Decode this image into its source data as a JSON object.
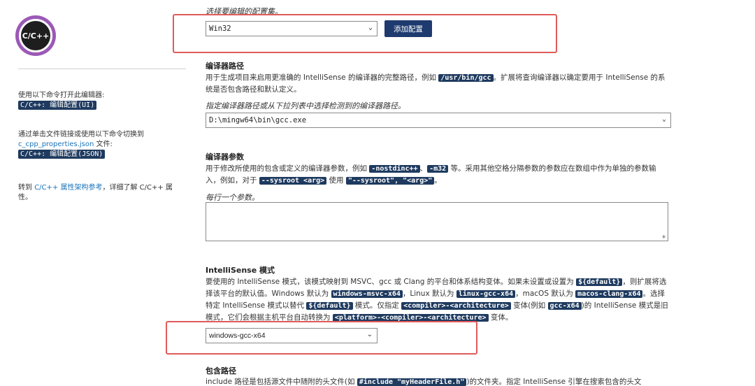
{
  "logo": {
    "text": "C/C++"
  },
  "sidebar": {
    "open_editor_text": "使用以下命令打开此编辑器:",
    "open_editor_cmd": "C/C++: 编辑配置(UI)",
    "switch_text_1": "通过单击文件链接或使用以下命令切换到",
    "switch_link": "c_cpp_properties.json",
    "switch_text_2": " 文件:",
    "switch_cmd": "C/C++: 编辑配置(JSON)",
    "ref_text_1": "转到 ",
    "ref_link": "C/C++ 属性架构参考",
    "ref_text_2": "，详细了解 C/C++ 属性。"
  },
  "config": {
    "hint": "选择要编辑的配置集。",
    "selected": "Win32",
    "add_button": "添加配置"
  },
  "compiler_path": {
    "title": "编译器路径",
    "desc_1": "用于生成项目来启用更准确的 IntelliSense 的编译器的完整路径，例如 ",
    "code_1": "/usr/bin/gcc",
    "desc_2": "。扩展将查询编译器以确定要用于 IntelliSense 的系统是否包含路径和默认定义。",
    "hint": "指定编译器路径或从下拉列表中选择检测到的编译器路径。",
    "value": "D:\\mingw64\\bin\\gcc.exe"
  },
  "compiler_args": {
    "title": "编译器参数",
    "desc_1": "用于修改所使用的包含或定义的编译器参数，例如 ",
    "code_1": "-nostdinc++",
    "desc_2": "、",
    "code_2": "-m32",
    "desc_3": " 等。采用其他空格分隔参数的参数应在数组中作为单独的参数输入，例如，对于 ",
    "code_3": "--sysroot <arg>",
    "desc_4": " 使用 ",
    "code_4": "\"--sysroot\", \"<arg>\"",
    "desc_5": "。",
    "hint": "每行一个参数。"
  },
  "intellisense_mode": {
    "title": "IntelliSense 模式",
    "desc_1": "要使用的 IntelliSense 模式，该模式映射到 MSVC、gcc 或 Clang 的平台和体系结构变体。如果未设置或设置为 ",
    "code_1": "${default}",
    "desc_2": "，则扩展将选择该平台的默认值。Windows 默认为 ",
    "code_2": "windows-msvc-x64",
    "desc_3": "，Linux 默认为 ",
    "code_3": "linux-gcc-x64",
    "desc_4": "，macOS 默认为 ",
    "code_4": "macos-clang-x64",
    "desc_5": "。选择特定 IntelliSense 模式以替代 ",
    "code_5": "${default}",
    "desc_6": " 模式。仅指定 ",
    "code_6": "<compiler>-<architecture>",
    "desc_7": " 变体(例如 ",
    "code_7": "gcc-x64",
    "desc_8": ")的 IntelliSense 模式是旧模式，它们会根据主机平台自动转换为 ",
    "code_8": "<platform>-<compiler>-<architecture>",
    "desc_9": " 变体。",
    "selected": "windows-gcc-x64"
  },
  "include_path": {
    "title": "包含路径",
    "desc_1": "include 路径是包括源文件中随附的头文件(如 ",
    "code_1": "#include \"myHeaderFile.h\"",
    "desc_2": ")的文件夹。指定 IntelliSense 引擎在搜索包含的头文"
  },
  "icons": {
    "chevron": "chevron-down-icon",
    "resize": "resize-grip-icon"
  },
  "colors": {
    "code_bg": "#1e3a5f",
    "button_bg": "#1e3a6f",
    "highlight": "#e05a5a",
    "logo": "#9b59b6"
  }
}
